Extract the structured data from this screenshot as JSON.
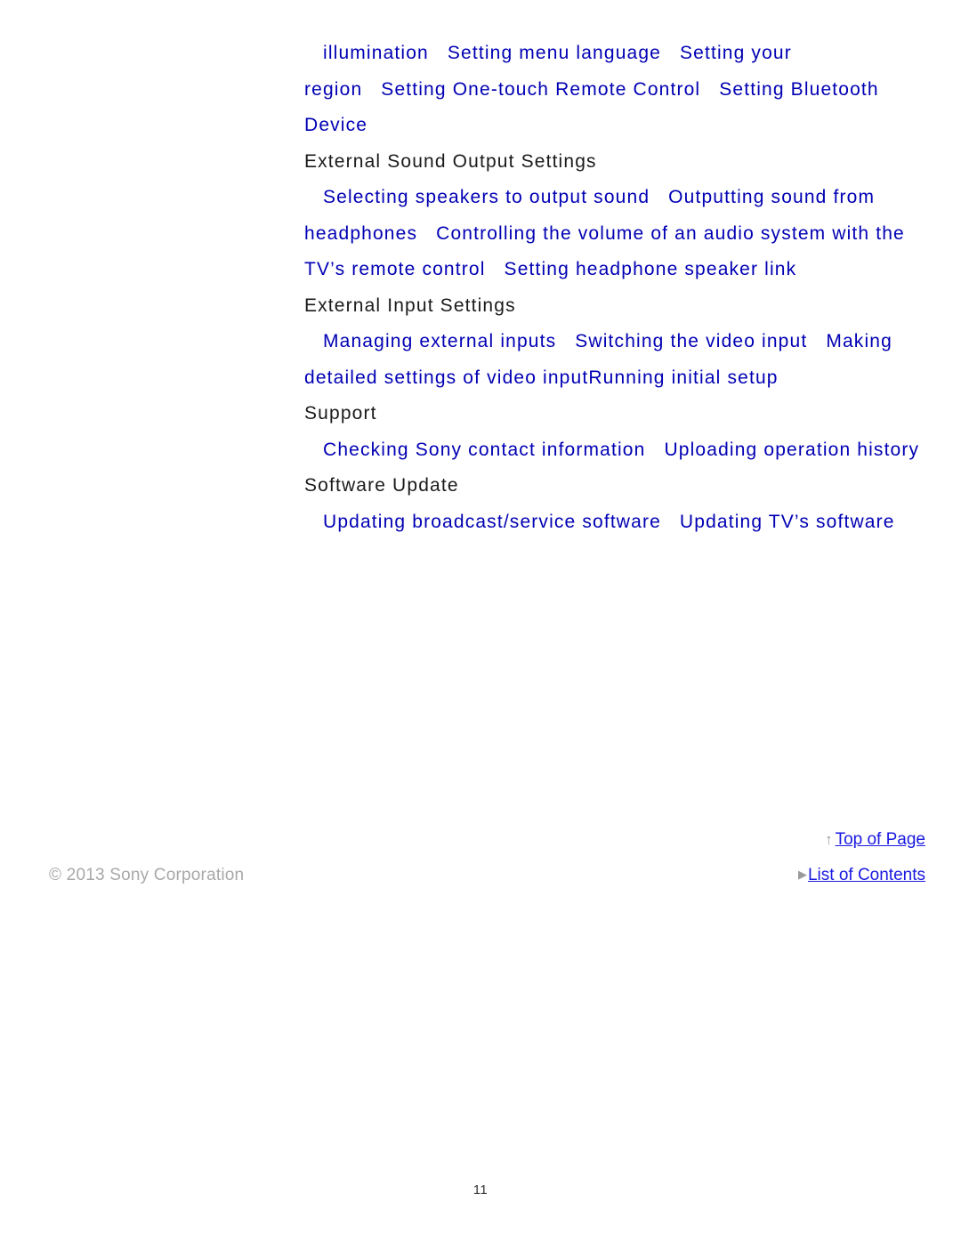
{
  "page": {
    "page_number": "11",
    "background_color": "#ffffff",
    "link_color": "#0000b4",
    "heading_color": "#1a1a1a",
    "footer_link_color": "#1a1ae0",
    "copyright_color": "#a8a8a8"
  },
  "toc": {
    "entries": [
      {
        "text": "illumination",
        "level": 1,
        "kind": "link"
      },
      {
        "text": "Setting menu language",
        "level": 1,
        "kind": "link"
      },
      {
        "text": "Setting your region",
        "level": 1,
        "kind": "link"
      },
      {
        "text": "Setting One-touch Remote Control",
        "level": 1,
        "kind": "link"
      },
      {
        "text": "Setting Bluetooth Device",
        "level": 1,
        "kind": "link"
      },
      {
        "text": "External Sound Output Settings",
        "level": 0,
        "kind": "heading"
      },
      {
        "text": "Selecting speakers to output sound",
        "level": 1,
        "kind": "link"
      },
      {
        "text": "Outputting sound from headphones",
        "level": 1,
        "kind": "link"
      },
      {
        "text": "Controlling the volume of an audio system with the TV’s remote control",
        "level": 1,
        "kind": "link"
      },
      {
        "text": "Setting headphone speaker link",
        "level": 1,
        "kind": "link"
      },
      {
        "text": "External Input Settings",
        "level": 0,
        "kind": "heading"
      },
      {
        "text": "Managing external inputs",
        "level": 1,
        "kind": "link"
      },
      {
        "text": "Switching the video input",
        "level": 1,
        "kind": "link"
      },
      {
        "text": "Making detailed settings of video input",
        "level": 1,
        "kind": "link"
      },
      {
        "text": "Running initial setup",
        "level": 0,
        "kind": "link"
      },
      {
        "text": "Support",
        "level": 0,
        "kind": "heading"
      },
      {
        "text": "Checking Sony contact information",
        "level": 1,
        "kind": "link"
      },
      {
        "text": "Uploading operation history",
        "level": 1,
        "kind": "link"
      },
      {
        "text": "Software Update",
        "level": 0,
        "kind": "heading"
      },
      {
        "text": "Updating broadcast/service software",
        "level": 1,
        "kind": "link"
      },
      {
        "text": "Updating TV’s software",
        "level": 1,
        "kind": "link"
      }
    ]
  },
  "footer": {
    "top_of_page": {
      "label": "Top of Page",
      "marker": "↑",
      "marker_name": "arrow-up-icon"
    },
    "list_of_contents": {
      "label": "List of Contents",
      "marker": "▶",
      "marker_name": "triangle-right-icon"
    },
    "copyright": "© 2013 Sony Corporation"
  }
}
